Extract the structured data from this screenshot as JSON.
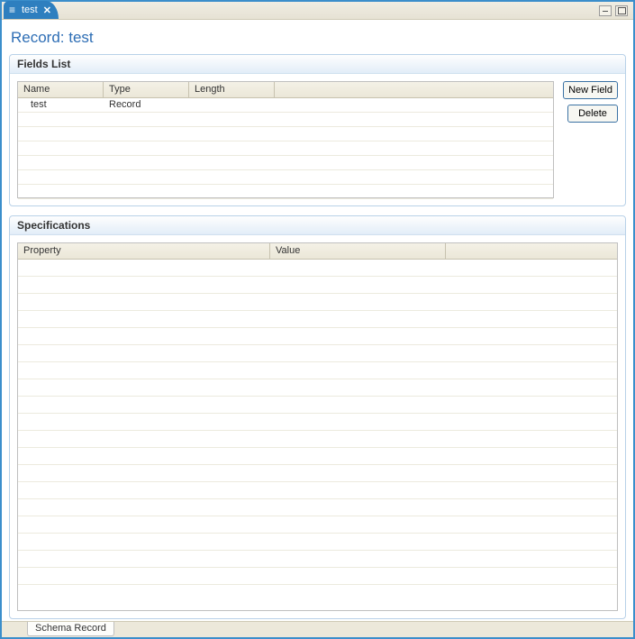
{
  "tab": {
    "label": "test"
  },
  "title": "Record: test",
  "fields_section": {
    "title": "Fields List",
    "columns": {
      "name": "Name",
      "type": "Type",
      "length": "Length"
    },
    "rows": [
      {
        "name": "test",
        "type": "Record",
        "length": ""
      }
    ]
  },
  "buttons": {
    "new_field": "New Field",
    "delete": "Delete"
  },
  "spec_section": {
    "title": "Specifications",
    "columns": {
      "property": "Property",
      "value": "Value"
    },
    "rows": []
  },
  "bottom_tab": "Schema Record"
}
